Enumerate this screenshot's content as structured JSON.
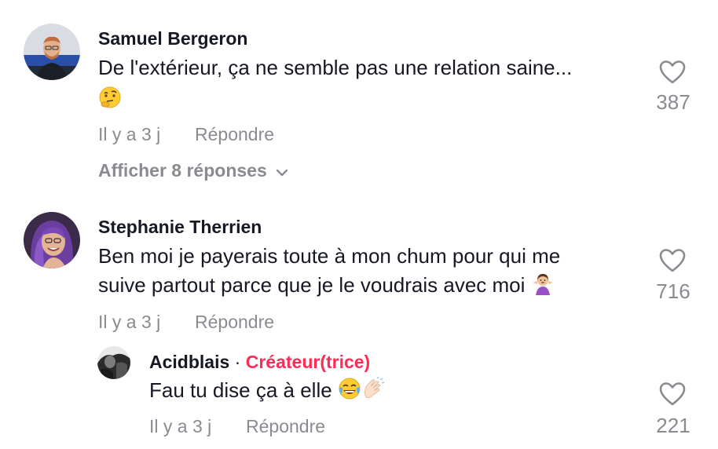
{
  "comments": [
    {
      "author": "Samuel Bergeron",
      "text": "De l'extérieur, ça ne semble pas une relation saine...",
      "emoji": "thinking-face",
      "time": "Il y a 3 j",
      "reply_label": "Répondre",
      "likes": "387",
      "view_replies": "Afficher 8 réponses"
    },
    {
      "author": "Stephanie Therrien",
      "text_line1": "Ben moi je payerais toute à mon chum pour qui me",
      "text_line2": "suive partout parce que je le voudrais avec moi",
      "emoji": "woman-shrugging",
      "time": "Il y a 3 j",
      "reply_label": "Répondre",
      "likes": "716"
    }
  ],
  "reply": {
    "author": "Acidblais",
    "separator": "·",
    "creator_badge": "Créateur(trice)",
    "text": "Fau tu dise ça à elle",
    "emojis": [
      "face-with-tears-of-joy",
      "clapping-hands"
    ],
    "time": "Il y a 3 j",
    "reply_label": "Répondre",
    "likes": "221"
  },
  "colors": {
    "text": "#161823",
    "muted": "#8a8b91",
    "creator": "#fe2c55"
  }
}
